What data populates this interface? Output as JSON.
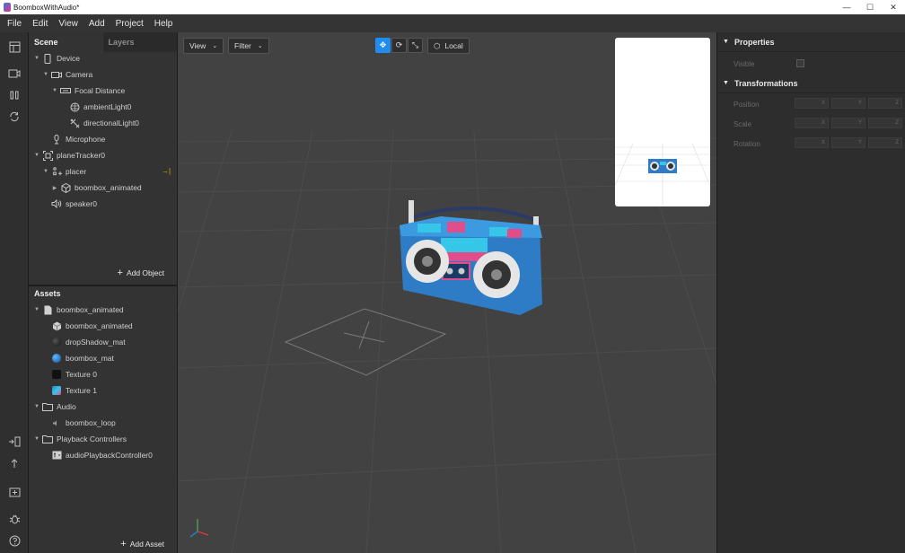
{
  "window": {
    "title": "BoomboxWithAudio*",
    "controls": {
      "minimize": "—",
      "maximize": "☐",
      "close": "✕"
    }
  },
  "menu": [
    "File",
    "Edit",
    "View",
    "Add",
    "Project",
    "Help"
  ],
  "scene_panel": {
    "tabs": [
      "Scene",
      "Layers"
    ],
    "tree": [
      {
        "label": "Device",
        "icon": "phone-icon"
      },
      {
        "label": "Camera",
        "icon": "camera-icon"
      },
      {
        "label": "Focal Distance",
        "icon": "focal-distance-icon"
      },
      {
        "label": "ambientLight0",
        "icon": "ambient-light-icon"
      },
      {
        "label": "directionalLight0",
        "icon": "directional-light-icon"
      },
      {
        "label": "Microphone",
        "icon": "microphone-icon"
      },
      {
        "label": "planeTracker0",
        "icon": "plane-tracker-icon"
      },
      {
        "label": "placer",
        "icon": "null-object-icon"
      },
      {
        "label": "boombox_animated",
        "icon": "3d-object-icon"
      },
      {
        "label": "speaker0",
        "icon": "speaker-icon"
      }
    ],
    "add_label": "Add Object"
  },
  "assets_panel": {
    "title": "Assets",
    "tree": [
      {
        "label": "boombox_animated",
        "icon": "file-icon"
      },
      {
        "label": "boombox_animated",
        "icon": "3d-object-icon"
      },
      {
        "label": "dropShadow_mat",
        "icon": "material-icon"
      },
      {
        "label": "boombox_mat",
        "icon": "material-icon"
      },
      {
        "label": "Texture 0",
        "icon": "texture-icon"
      },
      {
        "label": "Texture 1",
        "icon": "texture-icon"
      },
      {
        "label": "Audio",
        "icon": "folder-icon"
      },
      {
        "label": "boombox_loop",
        "icon": "audio-icon"
      },
      {
        "label": "Playback Controllers",
        "icon": "folder-icon"
      },
      {
        "label": "audioPlaybackController0",
        "icon": "playback-controller-icon"
      }
    ],
    "add_label": "Add Asset"
  },
  "viewport": {
    "view_label": "View",
    "filter_label": "Filter",
    "local_label": "Local",
    "accent": "#1f8df0"
  },
  "inspector": {
    "properties_title": "Properties",
    "visible_label": "Visible",
    "transformations_title": "Transformations",
    "rows": [
      "Position",
      "Scale",
      "Rotation"
    ],
    "axes": [
      "X",
      "Y",
      "Z"
    ]
  }
}
